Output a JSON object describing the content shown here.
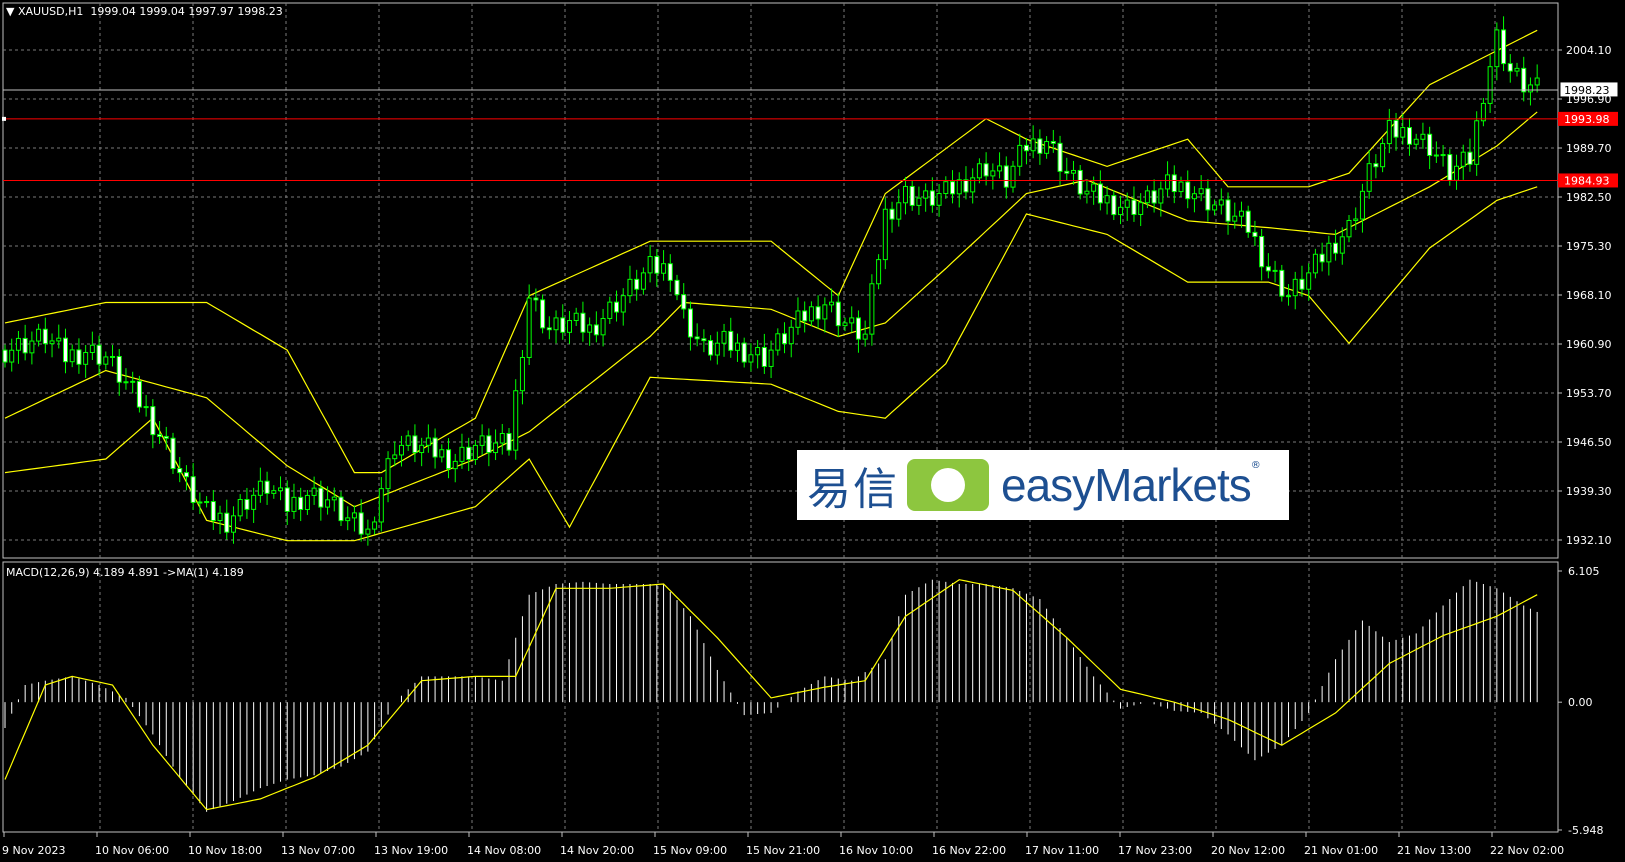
{
  "window": {
    "header_symbol": "XAUUSD,H1",
    "header_ohlc": "1999.04 1999.04 1997.97 1998.23",
    "macd_label": "MACD(12,26,9) 4.189 4.891  ->MA(1) 4.189"
  },
  "logo": {
    "cn_text": "易信",
    "en_text": "easyMarkets",
    "reg_mark": "®"
  },
  "chart_data": {
    "type": "candlestick",
    "symbol": "XAUUSD",
    "timeframe": "H1",
    "price_axis": {
      "ticks": [
        2004.1,
        1996.9,
        1989.7,
        1982.5,
        1975.3,
        1968.1,
        1960.9,
        1953.7,
        1946.5,
        1939.3,
        1932.1
      ],
      "tick_labels": [
        "2004.10",
        "1996.90",
        "1989.70",
        "1982.50",
        "1975.30",
        "1968.10",
        "1960.90",
        "1953.70",
        "1946.50",
        "1939.30",
        "1932.10"
      ]
    },
    "current_price": {
      "value": 1998.23,
      "label": "1998.23",
      "color": "#000000"
    },
    "horizontal_levels": [
      {
        "value": 1993.98,
        "label": "1993.98",
        "color": "#ff0000"
      },
      {
        "value": 1984.93,
        "label": "1984.93",
        "color": "#ff0000"
      }
    ],
    "time_labels": [
      "9 Nov 2023",
      "10 Nov 06:00",
      "10 Nov 18:00",
      "13 Nov 07:00",
      "13 Nov 19:00",
      "14 Nov 08:00",
      "14 Nov 20:00",
      "15 Nov 09:00",
      "15 Nov 21:00",
      "16 Nov 10:00",
      "16 Nov 22:00",
      "17 Nov 11:00",
      "17 Nov 23:00",
      "20 Nov 12:00",
      "21 Nov 01:00",
      "21 Nov 13:00",
      "22 Nov 02:00"
    ],
    "close_path": [
      [
        0,
        1960
      ],
      [
        3,
        1961
      ],
      [
        6,
        1962
      ],
      [
        9,
        1959
      ],
      [
        12,
        1960
      ],
      [
        15,
        1959
      ],
      [
        18,
        1955
      ],
      [
        21,
        1951
      ],
      [
        24,
        1946
      ],
      [
        27,
        1940
      ],
      [
        30,
        1936
      ],
      [
        33,
        1935
      ],
      [
        36,
        1938
      ],
      [
        39,
        1940
      ],
      [
        42,
        1937
      ],
      [
        45,
        1939
      ],
      [
        48,
        1938
      ],
      [
        51,
        1935
      ],
      [
        54,
        1933
      ],
      [
        56,
        1940
      ],
      [
        58,
        1946
      ],
      [
        61,
        1946
      ],
      [
        64,
        1945
      ],
      [
        67,
        1944
      ],
      [
        70,
        1946
      ],
      [
        73,
        1946
      ],
      [
        75,
        1946
      ],
      [
        78,
        1968
      ],
      [
        81,
        1963
      ],
      [
        84,
        1964
      ],
      [
        87,
        1963
      ],
      [
        90,
        1966
      ],
      [
        93,
        1969
      ],
      [
        96,
        1972
      ],
      [
        99,
        1972
      ],
      [
        101,
        1965
      ],
      [
        104,
        1960
      ],
      [
        107,
        1961
      ],
      [
        110,
        1960
      ],
      [
        113,
        1959
      ],
      [
        116,
        1962
      ],
      [
        119,
        1965
      ],
      [
        122,
        1967
      ],
      [
        125,
        1964
      ],
      [
        128,
        1962
      ],
      [
        131,
        1980
      ],
      [
        134,
        1983
      ],
      [
        137,
        1982
      ],
      [
        140,
        1983
      ],
      [
        143,
        1985
      ],
      [
        146,
        1987
      ],
      [
        149,
        1985
      ],
      [
        152,
        1990
      ],
      [
        155,
        1991
      ],
      [
        158,
        1986
      ],
      [
        161,
        1983
      ],
      [
        164,
        1982
      ],
      [
        167,
        1981
      ],
      [
        170,
        1982
      ],
      [
        173,
        1984
      ],
      [
        176,
        1984
      ],
      [
        179,
        1982
      ],
      [
        182,
        1980
      ],
      [
        185,
        1978
      ],
      [
        188,
        1972
      ],
      [
        191,
        1968
      ],
      [
        194,
        1971
      ],
      [
        197,
        1975
      ],
      [
        200,
        1978
      ],
      [
        203,
        1986
      ],
      [
        206,
        1992
      ],
      [
        209,
        1992
      ],
      [
        212,
        1990
      ],
      [
        215,
        1986
      ],
      [
        218,
        1988
      ],
      [
        220,
        1998
      ],
      [
        222,
        2006
      ],
      [
        224,
        2001
      ],
      [
        226,
        1999
      ],
      [
        228,
        1998.23
      ]
    ],
    "bollinger_bands": {
      "color": "#ffff00",
      "upper": [
        [
          0,
          1964
        ],
        [
          15,
          1967
        ],
        [
          30,
          1967
        ],
        [
          42,
          1960
        ],
        [
          52,
          1942
        ],
        [
          56,
          1942
        ],
        [
          70,
          1950
        ],
        [
          78,
          1968
        ],
        [
          96,
          1976
        ],
        [
          114,
          1976
        ],
        [
          124,
          1968
        ],
        [
          131,
          1983
        ],
        [
          146,
          1994
        ],
        [
          152,
          1991
        ],
        [
          164,
          1987
        ],
        [
          176,
          1991
        ],
        [
          182,
          1984
        ],
        [
          194,
          1984
        ],
        [
          200,
          1986
        ],
        [
          212,
          1999
        ],
        [
          228,
          2007
        ]
      ],
      "middle": [
        [
          0,
          1950
        ],
        [
          15,
          1957
        ],
        [
          30,
          1953
        ],
        [
          42,
          1943
        ],
        [
          52,
          1937
        ],
        [
          70,
          1944
        ],
        [
          78,
          1948
        ],
        [
          96,
          1962
        ],
        [
          101,
          1967
        ],
        [
          114,
          1966
        ],
        [
          124,
          1962
        ],
        [
          131,
          1964
        ],
        [
          140,
          1972
        ],
        [
          152,
          1983
        ],
        [
          161,
          1985
        ],
        [
          176,
          1979
        ],
        [
          188,
          1978
        ],
        [
          198,
          1977
        ],
        [
          212,
          1984
        ],
        [
          222,
          1990
        ],
        [
          228,
          1995
        ]
      ],
      "lower": [
        [
          0,
          1942
        ],
        [
          15,
          1944
        ],
        [
          22,
          1950
        ],
        [
          30,
          1935
        ],
        [
          42,
          1932
        ],
        [
          52,
          1932
        ],
        [
          70,
          1937
        ],
        [
          78,
          1944
        ],
        [
          84,
          1934
        ],
        [
          96,
          1956
        ],
        [
          114,
          1955
        ],
        [
          124,
          1951
        ],
        [
          131,
          1950
        ],
        [
          140,
          1958
        ],
        [
          152,
          1980
        ],
        [
          164,
          1977
        ],
        [
          176,
          1970
        ],
        [
          188,
          1970
        ],
        [
          194,
          1968
        ],
        [
          200,
          1961
        ],
        [
          212,
          1975
        ],
        [
          222,
          1982
        ],
        [
          228,
          1984
        ]
      ]
    },
    "macd": {
      "axis_ticks": [
        6.105,
        0.0,
        -5.948
      ],
      "axis_labels": [
        "6.105",
        "0.00",
        "-5.948"
      ],
      "histogram": [
        [
          0,
          -1.2
        ],
        [
          3,
          0.8
        ],
        [
          6,
          1.0
        ],
        [
          10,
          1.2
        ],
        [
          14,
          0.8
        ],
        [
          18,
          0.2
        ],
        [
          22,
          -1.5
        ],
        [
          26,
          -3.5
        ],
        [
          30,
          -5.1
        ],
        [
          34,
          -4.6
        ],
        [
          38,
          -4.0
        ],
        [
          42,
          -3.6
        ],
        [
          46,
          -3.4
        ],
        [
          50,
          -3.0
        ],
        [
          54,
          -2.3
        ],
        [
          58,
          0.0
        ],
        [
          62,
          1.2
        ],
        [
          66,
          1.2
        ],
        [
          70,
          1.2
        ],
        [
          74,
          1.0
        ],
        [
          78,
          5.0
        ],
        [
          82,
          5.5
        ],
        [
          86,
          5.6
        ],
        [
          90,
          5.5
        ],
        [
          94,
          5.5
        ],
        [
          98,
          5.5
        ],
        [
          102,
          4.0
        ],
        [
          106,
          1.5
        ],
        [
          110,
          -0.6
        ],
        [
          114,
          -0.5
        ],
        [
          118,
          0.5
        ],
        [
          122,
          1.2
        ],
        [
          126,
          1.0
        ],
        [
          131,
          2.0
        ],
        [
          134,
          5.0
        ],
        [
          138,
          5.7
        ],
        [
          142,
          5.5
        ],
        [
          146,
          5.5
        ],
        [
          150,
          5.3
        ],
        [
          154,
          4.8
        ],
        [
          158,
          3.0
        ],
        [
          162,
          1.2
        ],
        [
          166,
          -0.3
        ],
        [
          170,
          0.0
        ],
        [
          174,
          -0.4
        ],
        [
          178,
          -0.5
        ],
        [
          182,
          -1.5
        ],
        [
          186,
          -2.7
        ],
        [
          190,
          -2.0
        ],
        [
          194,
          -0.5
        ],
        [
          198,
          2.0
        ],
        [
          202,
          3.8
        ],
        [
          206,
          2.8
        ],
        [
          210,
          3.2
        ],
        [
          214,
          4.5
        ],
        [
          218,
          5.7
        ],
        [
          222,
          5.3
        ],
        [
          226,
          4.5
        ],
        [
          228,
          4.2
        ]
      ],
      "signal": [
        [
          0,
          -3.6
        ],
        [
          6,
          0.8
        ],
        [
          10,
          1.2
        ],
        [
          16,
          0.8
        ],
        [
          22,
          -2.0
        ],
        [
          30,
          -5.0
        ],
        [
          38,
          -4.5
        ],
        [
          46,
          -3.5
        ],
        [
          54,
          -2.0
        ],
        [
          62,
          1.0
        ],
        [
          70,
          1.2
        ],
        [
          76,
          1.2
        ],
        [
          82,
          5.3
        ],
        [
          90,
          5.3
        ],
        [
          98,
          5.5
        ],
        [
          106,
          3.0
        ],
        [
          114,
          0.2
        ],
        [
          122,
          0.7
        ],
        [
          128,
          1.0
        ],
        [
          134,
          4.0
        ],
        [
          142,
          5.7
        ],
        [
          150,
          5.2
        ],
        [
          158,
          3.0
        ],
        [
          166,
          0.6
        ],
        [
          174,
          0.0
        ],
        [
          182,
          -0.8
        ],
        [
          190,
          -2.0
        ],
        [
          198,
          -0.5
        ],
        [
          206,
          1.8
        ],
        [
          214,
          3.1
        ],
        [
          222,
          4.0
        ],
        [
          228,
          5.0
        ]
      ]
    }
  }
}
